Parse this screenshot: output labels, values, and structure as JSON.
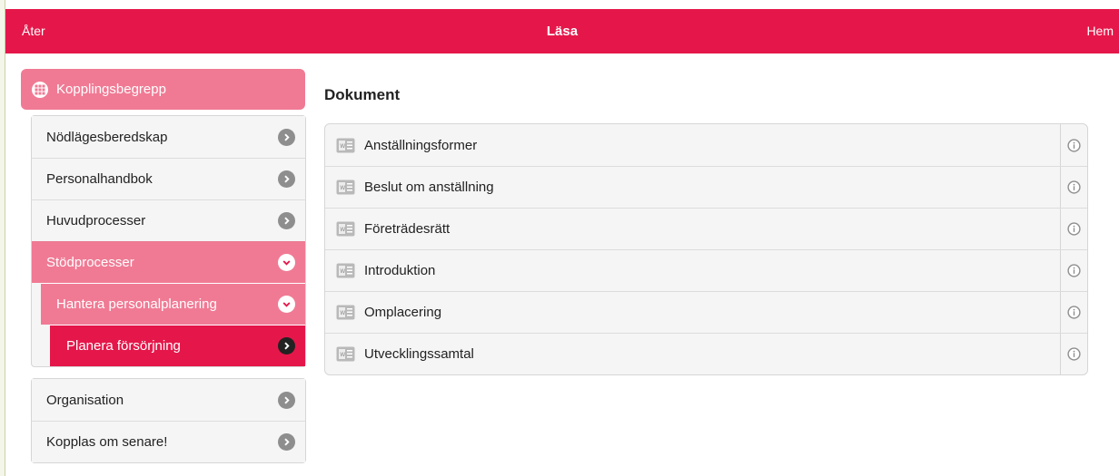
{
  "header": {
    "back_label": "Åter",
    "title": "Läsa",
    "home_label": "Hem"
  },
  "colors": {
    "brand": "#e5174a",
    "brand_light": "#f07a94"
  },
  "sidebar": {
    "category": {
      "label": "Kopplingsbegrepp",
      "icon": "grid-icon"
    },
    "items": [
      {
        "label": "Nödlägesberedskap",
        "state": "collapsed"
      },
      {
        "label": "Personalhandbok",
        "state": "collapsed"
      },
      {
        "label": "Huvudprocesser",
        "state": "collapsed"
      },
      {
        "label": "Stödprocesser",
        "state": "expanded"
      }
    ],
    "sub_item": {
      "label": "Hantera personalplanering",
      "state": "expanded"
    },
    "sub_sub_item": {
      "label": "Planera försörjning",
      "state": "selected"
    },
    "items_after": [
      {
        "label": "Organisation",
        "state": "collapsed"
      },
      {
        "label": "Kopplas om senare!",
        "state": "collapsed"
      }
    ]
  },
  "main": {
    "heading": "Dokument",
    "documents": [
      {
        "label": "Anställningsformer",
        "icon": "word-document-icon"
      },
      {
        "label": "Beslut om anställning",
        "icon": "word-document-icon"
      },
      {
        "label": "Företrädesrätt",
        "icon": "word-document-icon"
      },
      {
        "label": "Introduktion",
        "icon": "word-document-icon"
      },
      {
        "label": "Omplacering",
        "icon": "word-document-icon"
      },
      {
        "label": "Utvecklingssamtal",
        "icon": "word-document-icon"
      }
    ]
  }
}
